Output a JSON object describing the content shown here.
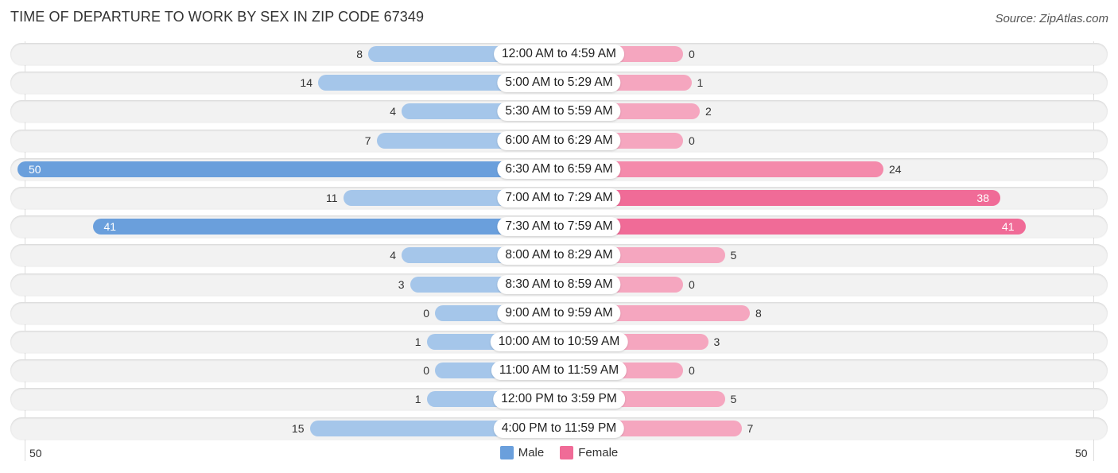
{
  "header": {
    "title": "TIME OF DEPARTURE TO WORK BY SEX IN ZIP CODE 67349",
    "source": "Source: ZipAtlas.com"
  },
  "colors": {
    "male_strong": "#6a9fdc",
    "male_light": "#a5c6ea",
    "female_strong": "#f06b97",
    "female_light": "#f5a6bf"
  },
  "chart_data": {
    "type": "bar",
    "orientation": "horizontal-diverging",
    "title": "TIME OF DEPARTURE TO WORK BY SEX IN ZIP CODE 67349",
    "categories": [
      "12:00 AM to 4:59 AM",
      "5:00 AM to 5:29 AM",
      "5:30 AM to 5:59 AM",
      "6:00 AM to 6:29 AM",
      "6:30 AM to 6:59 AM",
      "7:00 AM to 7:29 AM",
      "7:30 AM to 7:59 AM",
      "8:00 AM to 8:29 AM",
      "8:30 AM to 8:59 AM",
      "9:00 AM to 9:59 AM",
      "10:00 AM to 10:59 AM",
      "11:00 AM to 11:59 AM",
      "12:00 PM to 3:59 PM",
      "4:00 PM to 11:59 PM"
    ],
    "series": [
      {
        "name": "Male",
        "values": [
          8,
          14,
          4,
          7,
          50,
          11,
          41,
          4,
          3,
          0,
          1,
          0,
          1,
          15
        ]
      },
      {
        "name": "Female",
        "values": [
          0,
          1,
          2,
          0,
          24,
          38,
          41,
          5,
          0,
          8,
          3,
          0,
          5,
          7
        ]
      }
    ],
    "axis": {
      "left_tick": "50",
      "right_tick": "50",
      "range": [
        0,
        50
      ]
    },
    "legend": {
      "position": "bottom-center",
      "entries": [
        "Male",
        "Female"
      ]
    },
    "grid": true
  }
}
